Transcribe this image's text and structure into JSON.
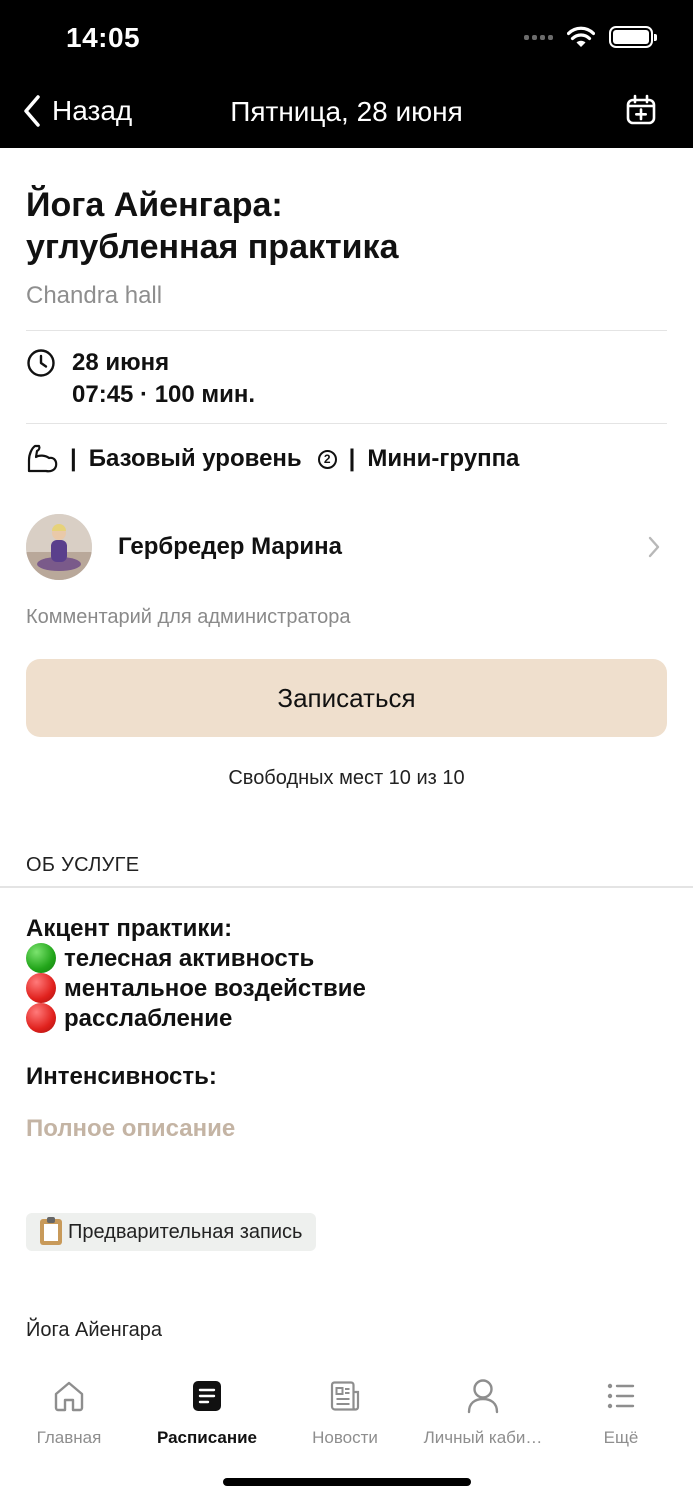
{
  "status_bar": {
    "time": "14:05"
  },
  "nav": {
    "back_label": "Назад",
    "title": "Пятница, 28 июня"
  },
  "class": {
    "title_line1": "Йога Айенгара:",
    "title_line2": "углубленная практика",
    "hall": "Chandra hall",
    "date": "28 июня",
    "time_duration": "07:45 · 100 мин.",
    "separator": "|",
    "level": "Базовый уровень",
    "level_help": "2",
    "group_type": "Мини-группа"
  },
  "trainer": {
    "name": "Гербредер Марина"
  },
  "comment_placeholder": "Комментарий для администратора",
  "signup_button": "Записаться",
  "free_spots": "Свободных мест 10 из 10",
  "about": {
    "section_title": "ОБ УСЛУГЕ",
    "accent_title": "Акцент практики:",
    "accents": [
      {
        "color": "green",
        "text": "телесная активность"
      },
      {
        "color": "red",
        "text": "ментальное воздействие"
      },
      {
        "color": "red",
        "text": "расслабление"
      }
    ],
    "intensity_label": "Интенсивность:",
    "full_description_link": "Полное описание",
    "tag": "Предварительная запись",
    "category": "Йога Айенгара"
  },
  "tabbar": {
    "items": [
      {
        "label": "Главная",
        "icon": "home-icon",
        "active": false
      },
      {
        "label": "Расписание",
        "icon": "schedule-icon",
        "active": true
      },
      {
        "label": "Новости",
        "icon": "news-icon",
        "active": false
      },
      {
        "label": "Личный каби…",
        "icon": "profile-icon",
        "active": false
      },
      {
        "label": "Ещё",
        "icon": "more-icon",
        "active": false
      }
    ]
  },
  "colors": {
    "accent_button": "#efdfcd",
    "link_muted": "#c4b4a4",
    "topbar": "#000000"
  }
}
